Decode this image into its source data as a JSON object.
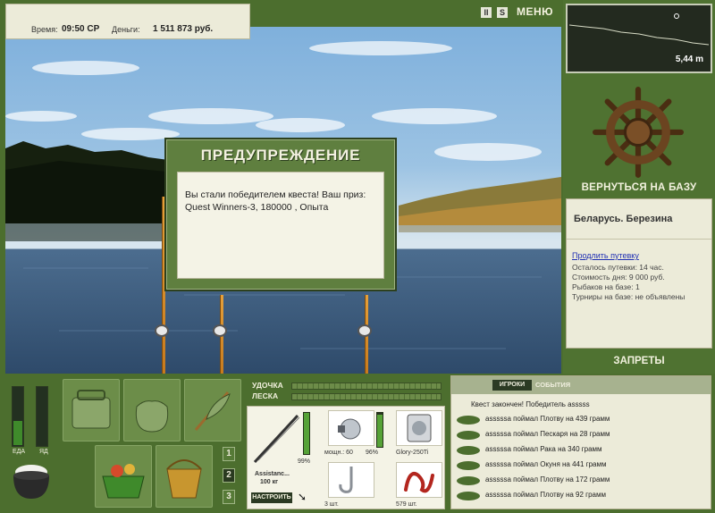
{
  "topbar": {
    "time_label": "Время:",
    "time_value": "09:50 СР",
    "money_label": "Деньги:",
    "money_value": "1 511 873 руб."
  },
  "top_icons": {
    "pause": "II",
    "sound": "S",
    "menu": "МЕНЮ"
  },
  "depth": {
    "value": "5,44 m"
  },
  "right_panel": {
    "back_button": "ВЕРНУТЬСЯ НА БАЗУ",
    "location_title": "Беларусь. Березина",
    "extend_link": "Продлить путевку",
    "lines": [
      "Осталось путевки: 14 час.",
      "Стоимость дня: 9 000 руб.",
      "Рыбаков на базе: 1",
      "Турниры на базе: не объявлены"
    ],
    "ban_button": "ЗАПРЕТЫ"
  },
  "dialog": {
    "title": "ПРЕДУПРЕЖДЕНИЕ",
    "message": "Вы стали победителем квеста! Ваш приз: Quest Winners-3, 180000 , Опыта"
  },
  "meters": {
    "food_label": "ЕДА",
    "poison_label": "ЯД",
    "food_level": 0.42,
    "poison_level": 0.0
  },
  "pages": [
    "1",
    "2",
    "3"
  ],
  "line_panel": {
    "rod_label": "УДОЧКА",
    "line_label": "ЛЕСКА"
  },
  "tackle": {
    "rod_name": "Assistanc...",
    "rod_weight": "100 кг",
    "rod_percent": "99%",
    "reel_power": "мощн.: 60",
    "reel_percent": "96%",
    "line_name": "Glory-250Ti",
    "hook_count": "3 шт.",
    "bait_count": "579 шт.",
    "setup_button": "НАСТРОИТЬ"
  },
  "log": {
    "tab_players": "ИГРОКИ",
    "tab_events": "СОБЫТИЯ",
    "header": "Квест закончен! Победитель asssss",
    "entries": [
      "asssssa поймал Плотву на 439 грамм",
      "asssssa поймал Пескаря на 28 грамм",
      "asssssa поймал Рака на 340 грамм",
      "asssssa поймал Окуня на 441 грамм",
      "asssssa поймал Плотву на 172 грамм",
      "asssssa поймал Плотву на 92 грамм"
    ]
  }
}
